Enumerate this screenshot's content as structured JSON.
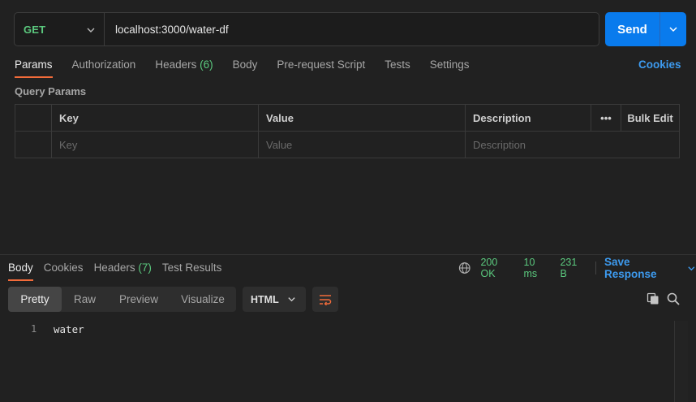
{
  "request": {
    "method": "GET",
    "url": "localhost:3000/water-df",
    "send_label": "Send"
  },
  "request_tabs": {
    "params": "Params",
    "authorization": "Authorization",
    "headers": "Headers",
    "headers_count": "(6)",
    "body": "Body",
    "pre_request": "Pre-request Script",
    "tests": "Tests",
    "settings": "Settings",
    "cookies": "Cookies"
  },
  "query_params": {
    "title": "Query Params",
    "columns": {
      "key": "Key",
      "value": "Value",
      "description": "Description",
      "more": "•••",
      "bulk_edit": "Bulk Edit"
    },
    "placeholders": {
      "key": "Key",
      "value": "Value",
      "description": "Description"
    }
  },
  "response_tabs": {
    "body": "Body",
    "cookies": "Cookies",
    "headers": "Headers",
    "headers_count": "(7)",
    "test_results": "Test Results"
  },
  "response_status": {
    "status": "200 OK",
    "time": "10 ms",
    "size": "231 B",
    "save_label": "Save Response"
  },
  "format": {
    "options": [
      "Pretty",
      "Raw",
      "Preview",
      "Visualize"
    ],
    "selected": "Pretty",
    "language": "HTML"
  },
  "response_body": {
    "lines": [
      {
        "num": "1",
        "text": "water"
      }
    ]
  },
  "colors": {
    "accent": "#097bed",
    "method": "#5bc97e",
    "active_tab": "#f26b3a",
    "link": "#3d9bf0"
  }
}
